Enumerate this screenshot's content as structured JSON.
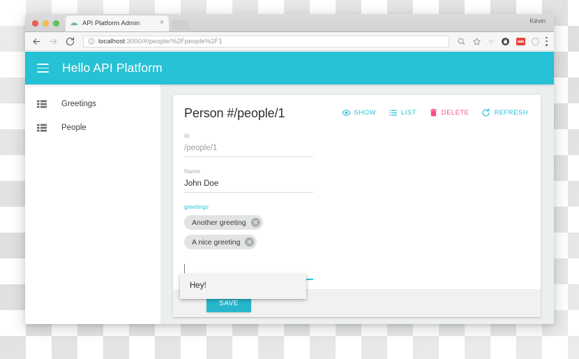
{
  "browser": {
    "profile_name": "Kévin",
    "tab": {
      "title": "API Platform Admin",
      "close_label": "×",
      "favicon": "api-platform-logo"
    },
    "url": {
      "host": "localhost",
      "path": ":3000/#/people/%2Fpeople%2F1",
      "full": "localhost:3000/#/people/%2Fpeople%2F1"
    },
    "nav": {
      "back": "back-arrow",
      "forward": "forward-arrow",
      "reload": "reload",
      "info": "site-info",
      "zoom": "zoom-search",
      "bookmark": "star",
      "extensions": [
        "puzzle",
        "flame",
        "red-badge",
        "gray-circle"
      ],
      "menu": "kebab-menu"
    }
  },
  "app": {
    "title": "Hello API Platform",
    "menu_icon": "hamburger-icon"
  },
  "sidebar": {
    "items": [
      {
        "label": "Greetings",
        "icon": "list-grid-icon"
      },
      {
        "label": "People",
        "icon": "list-grid-icon"
      }
    ]
  },
  "record": {
    "title": "Person #/people/1",
    "actions": [
      {
        "label": "SHOW",
        "icon": "eye-icon",
        "color": "#26c1d4"
      },
      {
        "label": "LIST",
        "icon": "list-icon",
        "color": "#26c1d4"
      },
      {
        "label": "DELETE",
        "icon": "trash-icon",
        "color": "#fc4f7f"
      },
      {
        "label": "REFRESH",
        "icon": "refresh-icon",
        "color": "#26c1d4"
      }
    ],
    "fields": {
      "id": {
        "label": "Id",
        "value": "/people/1",
        "disabled": true
      },
      "name": {
        "label": "Name",
        "value": "John Doe",
        "disabled": false
      },
      "greetings": {
        "label": "greetings",
        "focused": true,
        "chips": [
          {
            "label": "Another greeting",
            "remove_icon": "close-circle-icon"
          },
          {
            "label": "A nice greeting",
            "remove_icon": "close-circle-icon"
          }
        ],
        "input_value": "",
        "suggestions": [
          "Hey!"
        ]
      }
    },
    "save_label": "SAVE"
  },
  "colors": {
    "primary": "#26c1d4",
    "accent": "#fc4f7f",
    "page_bg": "#eceff0",
    "card_bg": "#ffffff"
  }
}
